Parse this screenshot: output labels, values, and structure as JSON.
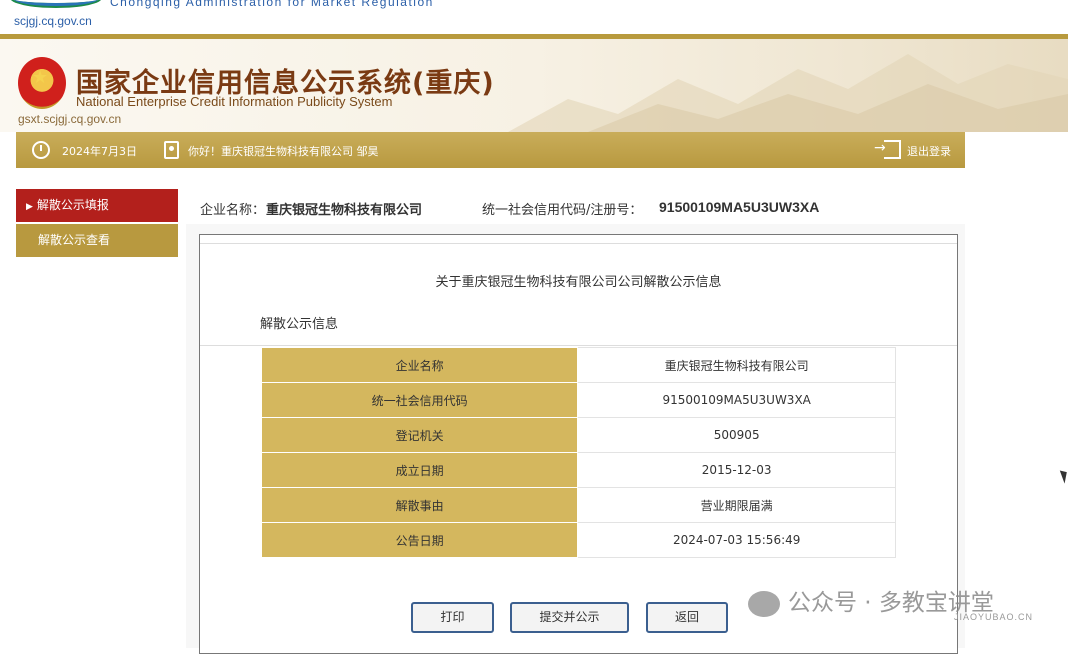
{
  "top": {
    "site_url": "scjgj.cq.gov.cn",
    "site_en": "Chongqing Administration for Market Regulation"
  },
  "header": {
    "title_cn": "国家企业信用信息公示系统(重庆)",
    "title_en": "National Enterprise Credit Information Publicity System",
    "url": "gsxt.scjgj.cq.gov.cn"
  },
  "infobar": {
    "date": "2024年7月3日",
    "greeting": "你好！重庆银冠生物科技有限公司  邹昊",
    "logout": "退出登录"
  },
  "sidebar": {
    "items": [
      {
        "label": "解散公示填报",
        "active": true
      },
      {
        "label": "解散公示查看",
        "active": false
      }
    ]
  },
  "company": {
    "name_label": "企业名称：",
    "name": "重庆银冠生物科技有限公司",
    "code_label": "统一社会信用代码/注册号：",
    "code": "91500109MA5U3UW3XA"
  },
  "panel": {
    "title": "关于重庆银冠生物科技有限公司公司解散公示信息",
    "section": "解散公示信息",
    "rows": [
      {
        "key": "企业名称",
        "value": "重庆银冠生物科技有限公司"
      },
      {
        "key": "统一社会信用代码",
        "value": "91500109MA5U3UW3XA"
      },
      {
        "key": "登记机关",
        "value": "500905"
      },
      {
        "key": "成立日期",
        "value": "2015-12-03"
      },
      {
        "key": "解散事由",
        "value": "营业期限届满"
      },
      {
        "key": "公告日期",
        "value": "2024-07-03 15:56:49"
      }
    ]
  },
  "buttons": {
    "print": "打印",
    "submit": "提交并公示",
    "back": "返回"
  },
  "watermark": {
    "text": "公众号 · 多教宝讲堂",
    "sub": "JIAOYUBAO.CN"
  },
  "colors": {
    "gold": "#b8993f",
    "red": "#b3201c",
    "table_key_bg": "#d4b75e"
  }
}
